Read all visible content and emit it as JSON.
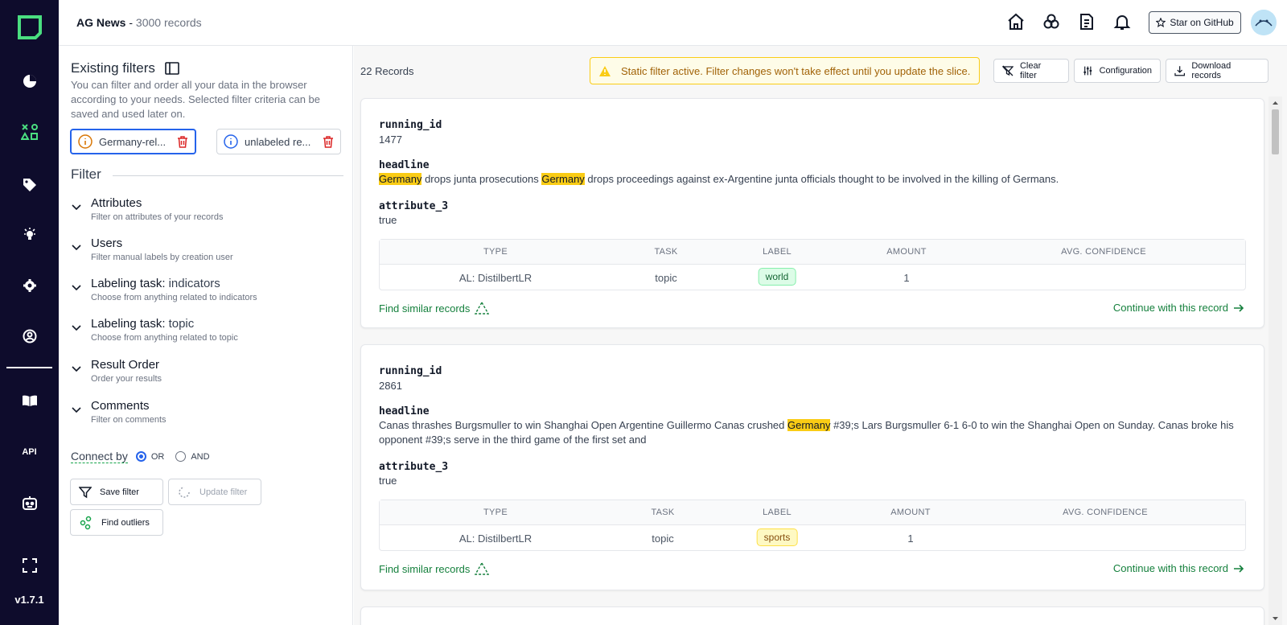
{
  "header": {
    "app_name": "AG News",
    "record_count": "3000 records",
    "separator": " - ",
    "star_button": "Star on GitHub"
  },
  "nav": {
    "version": "v1.7.1",
    "icons": [
      "logo-icon",
      "overview-icon",
      "shapes-icon",
      "labels-icon",
      "heuristics-icon",
      "settings-icon",
      "account-icon",
      "docs-icon",
      "api-icon",
      "bot-icon",
      "fullscreen-icon"
    ],
    "api_label": "API",
    "accent": "#4ade80",
    "background": "#0e0c2c"
  },
  "filter_panel": {
    "existing_title": "Existing filters",
    "existing_desc": "You can filter and order all your data in the browser according to your needs. Selected filter criteria can be saved and used later on.",
    "saved_filters": [
      {
        "label": "Germany-rel...",
        "icon_color": "#d97706"
      },
      {
        "label": "unlabeled re...",
        "icon_color": "#2563eb"
      }
    ],
    "filter_heading": "Filter",
    "groups": [
      {
        "title": "Attributes",
        "task": "",
        "subtitle": "Filter on attributes of your records"
      },
      {
        "title": "Users",
        "task": "",
        "subtitle": "Filter manual labels by creation user"
      },
      {
        "title": "Labeling task:",
        "task": "indicators",
        "subtitle": "Choose from anything related to indicators"
      },
      {
        "title": "Labeling task:",
        "task": "topic",
        "subtitle": "Choose from anything related to topic"
      },
      {
        "title": "Result Order",
        "task": "",
        "subtitle": "Order your results"
      },
      {
        "title": "Comments",
        "task": "",
        "subtitle": "Filter on comments"
      }
    ],
    "connect_by": "Connect by",
    "connect_options": [
      "OR",
      "AND"
    ],
    "connect_selected": "OR",
    "save_filter": "Save filter",
    "update_filter": "Update filter",
    "find_outliers": "Find outliers"
  },
  "records": {
    "count": "22 Records",
    "warning": "Static filter active. Filter changes won't take effect until you update the slice.",
    "clear_filter": "Clear filter",
    "configuration": "Configuration",
    "download": "Download records",
    "table_headers": [
      "TYPE",
      "TASK",
      "LABEL",
      "AMOUNT",
      "AVG. CONFIDENCE"
    ],
    "find_similar": "Find similar records",
    "continue": "Continue with this record",
    "items": [
      {
        "running_id_label": "running_id",
        "running_id": "1477",
        "headline_label": "headline",
        "headline_parts": [
          {
            "t": "Germany",
            "h": true
          },
          {
            "t": " drops junta prosecutions ",
            "h": false
          },
          {
            "t": "Germany",
            "h": true
          },
          {
            "t": " drops proceedings against ex-Argentine junta officials thought to be involved in the killing of Germans.",
            "h": false
          }
        ],
        "attr_label": "attribute_3",
        "attr_value": "true",
        "row": {
          "type": "AL: DistilbertLR",
          "task": "topic",
          "label": "world",
          "amount": "1",
          "confidence": ""
        }
      },
      {
        "running_id_label": "running_id",
        "running_id": "2861",
        "headline_label": "headline",
        "headline_parts": [
          {
            "t": "Canas thrashes Burgsmuller to win Shanghai Open Argentine Guillermo Canas crushed ",
            "h": false
          },
          {
            "t": "Germany",
            "h": true
          },
          {
            "t": " #39;s Lars Burgsmuller 6-1 6-0 to win the Shanghai Open on Sunday. Canas broke his opponent #39;s serve in the third game of the first set and",
            "h": false
          }
        ],
        "attr_label": "attribute_3",
        "attr_value": "true",
        "row": {
          "type": "AL: DistilbertLR",
          "task": "topic",
          "label": "sports",
          "amount": "1",
          "confidence": ""
        }
      }
    ]
  }
}
